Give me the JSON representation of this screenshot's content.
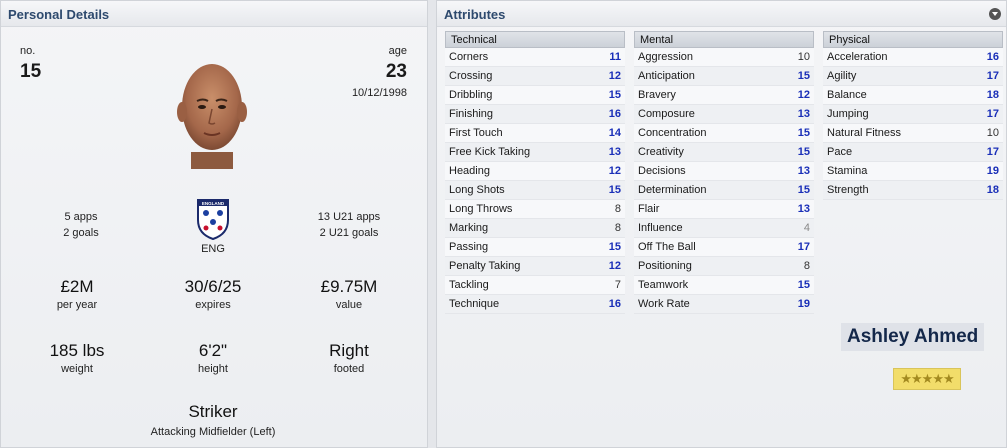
{
  "personal": {
    "title": "Personal Details",
    "no_label": "no.",
    "no_value": "15",
    "age_label": "age",
    "age_value": "23",
    "dob": "10/12/1998",
    "apps": "5 apps",
    "goals": "2 goals",
    "nation": "ENG",
    "u21_apps": "13 U21 apps",
    "u21_goals": "2 U21 goals",
    "wage": "£2M",
    "wage_label": "per year",
    "contract": "30/6/25",
    "contract_label": "expires",
    "value": "£9.75M",
    "value_label": "value",
    "weight": "185 lbs",
    "weight_label": "weight",
    "height": "6'2\"",
    "height_label": "height",
    "foot": "Right",
    "foot_label": "footed",
    "position": "Striker",
    "secondary_position": "Attacking Midfielder (Left)"
  },
  "attributes": {
    "title": "Attributes",
    "technical": {
      "header": "Technical",
      "rows": [
        {
          "name": "Corners",
          "value": "11"
        },
        {
          "name": "Crossing",
          "value": "12"
        },
        {
          "name": "Dribbling",
          "value": "15"
        },
        {
          "name": "Finishing",
          "value": "16"
        },
        {
          "name": "First Touch",
          "value": "14"
        },
        {
          "name": "Free Kick Taking",
          "value": "13"
        },
        {
          "name": "Heading",
          "value": "12"
        },
        {
          "name": "Long Shots",
          "value": "15"
        },
        {
          "name": "Long Throws",
          "value": "8"
        },
        {
          "name": "Marking",
          "value": "8"
        },
        {
          "name": "Passing",
          "value": "15"
        },
        {
          "name": "Penalty Taking",
          "value": "12"
        },
        {
          "name": "Tackling",
          "value": "7"
        },
        {
          "name": "Technique",
          "value": "16"
        }
      ]
    },
    "mental": {
      "header": "Mental",
      "rows": [
        {
          "name": "Aggression",
          "value": "10"
        },
        {
          "name": "Anticipation",
          "value": "15"
        },
        {
          "name": "Bravery",
          "value": "12"
        },
        {
          "name": "Composure",
          "value": "13"
        },
        {
          "name": "Concentration",
          "value": "15"
        },
        {
          "name": "Creativity",
          "value": "15"
        },
        {
          "name": "Decisions",
          "value": "13"
        },
        {
          "name": "Determination",
          "value": "15"
        },
        {
          "name": "Flair",
          "value": "13"
        },
        {
          "name": "Influence",
          "value": "4"
        },
        {
          "name": "Off The Ball",
          "value": "17"
        },
        {
          "name": "Positioning",
          "value": "8"
        },
        {
          "name": "Teamwork",
          "value": "15"
        },
        {
          "name": "Work Rate",
          "value": "19"
        }
      ]
    },
    "physical": {
      "header": "Physical",
      "rows": [
        {
          "name": "Acceleration",
          "value": "16"
        },
        {
          "name": "Agility",
          "value": "17"
        },
        {
          "name": "Balance",
          "value": "18"
        },
        {
          "name": "Jumping",
          "value": "17"
        },
        {
          "name": "Natural Fitness",
          "value": "10"
        },
        {
          "name": "Pace",
          "value": "17"
        },
        {
          "name": "Stamina",
          "value": "19"
        },
        {
          "name": "Strength",
          "value": "18"
        }
      ]
    },
    "player_name": "Ashley Ahmed",
    "stars": "★★★★★"
  },
  "colors": {
    "high_value": "#1a2fb8",
    "mid_value": "#333333",
    "low_value": "#888888",
    "title": "#2e4a6e",
    "star_bg": "#f2dd6a"
  }
}
